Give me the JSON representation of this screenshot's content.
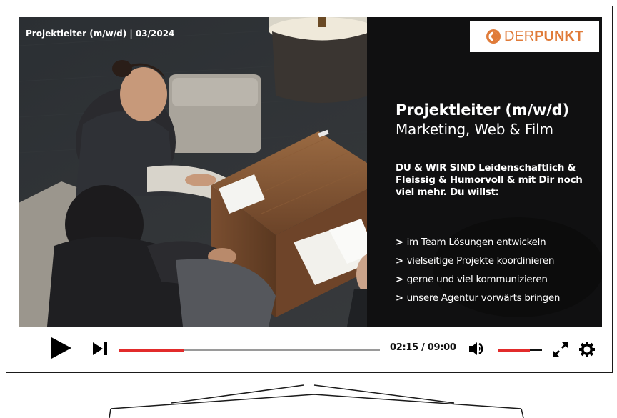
{
  "video": {
    "caption": "Projektleiter (m/w/d) | 03/2024",
    "logo": {
      "part1": "DER",
      "part2": "PUNKT",
      "color": "#e07b39"
    },
    "headline": {
      "title": "Projektleiter (m/w/d)",
      "subtitle": "Marketing, Web & Film"
    },
    "claim": "DU & WIR SIND Leidenschaftlich & Fleissig & Humorvoll & mit Dir noch viel mehr. Du willst:",
    "bullets": [
      "im Team Lösungen entwickeln",
      "vielseitige Projekte koordinieren",
      "gerne und viel kommunizieren",
      "unsere Agentur vorwärts bringen"
    ]
  },
  "player": {
    "time_display": "02:15 / 09:00",
    "progress_fraction": 0.25,
    "volume_fraction": 0.72,
    "accent_color": "#e22b2b",
    "icons": {
      "play": "play-icon",
      "next": "skip-next-icon",
      "volume": "volume-icon",
      "fullscreen": "fullscreen-icon",
      "settings": "gear-icon"
    }
  }
}
